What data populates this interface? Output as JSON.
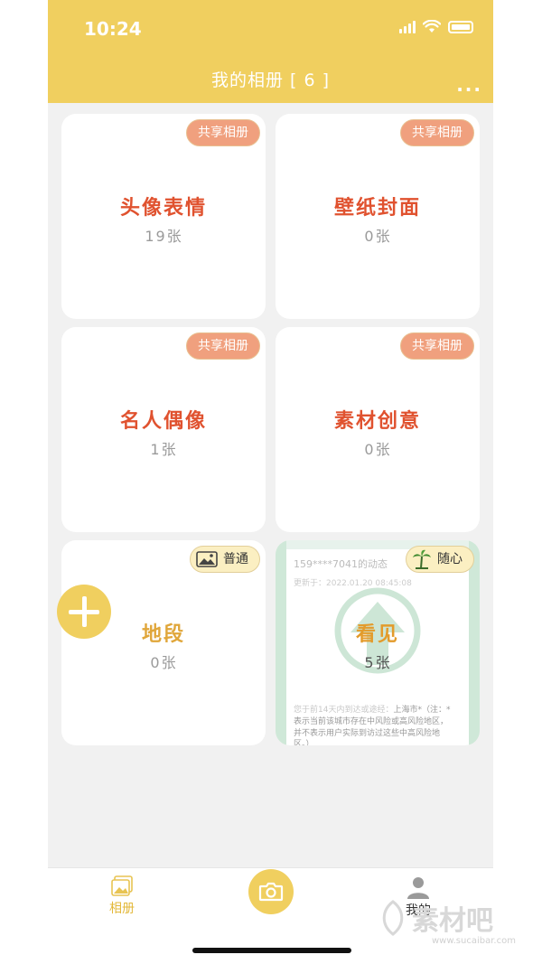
{
  "status": {
    "time": "10:24"
  },
  "header": {
    "title": "我的相册 [ 6 ]",
    "more": "..."
  },
  "albums": [
    {
      "name": "头像表情",
      "count": "19",
      "unit": "张",
      "badge": "共享相册"
    },
    {
      "name": "壁纸封面",
      "count": "0",
      "unit": "张",
      "badge": "共享相册"
    },
    {
      "name": "名人偶像",
      "count": "1",
      "unit": "张",
      "badge": "共享相册"
    },
    {
      "name": "素材创意",
      "count": "0",
      "unit": "张",
      "badge": "共享相册"
    },
    {
      "name": "地段",
      "count": "0",
      "unit": "张",
      "badge": "普通"
    },
    {
      "name": "看见",
      "count": "5",
      "unit": "张",
      "badge": "随心"
    }
  ],
  "cover_text": {
    "line1": "159****7041的动态",
    "line2": "更新于：2022.01.20 08:45:08",
    "line3a": "您于前14天内到达或途经：",
    "line3b": "上海市*（注：*",
    "line4": "表示当前该城市存在中风险或高风险地区，",
    "line5": "并不表示用户实际到访过这些中高风险地",
    "line6": "区。）"
  },
  "tabs": {
    "album": "相册",
    "me": "我的"
  },
  "watermark": {
    "text": "素材吧",
    "url": "www.sucaibar.com"
  },
  "colors": {
    "accent": "#f0cf5f",
    "album_name": "#e0522f",
    "badge": "#f0a07e"
  }
}
